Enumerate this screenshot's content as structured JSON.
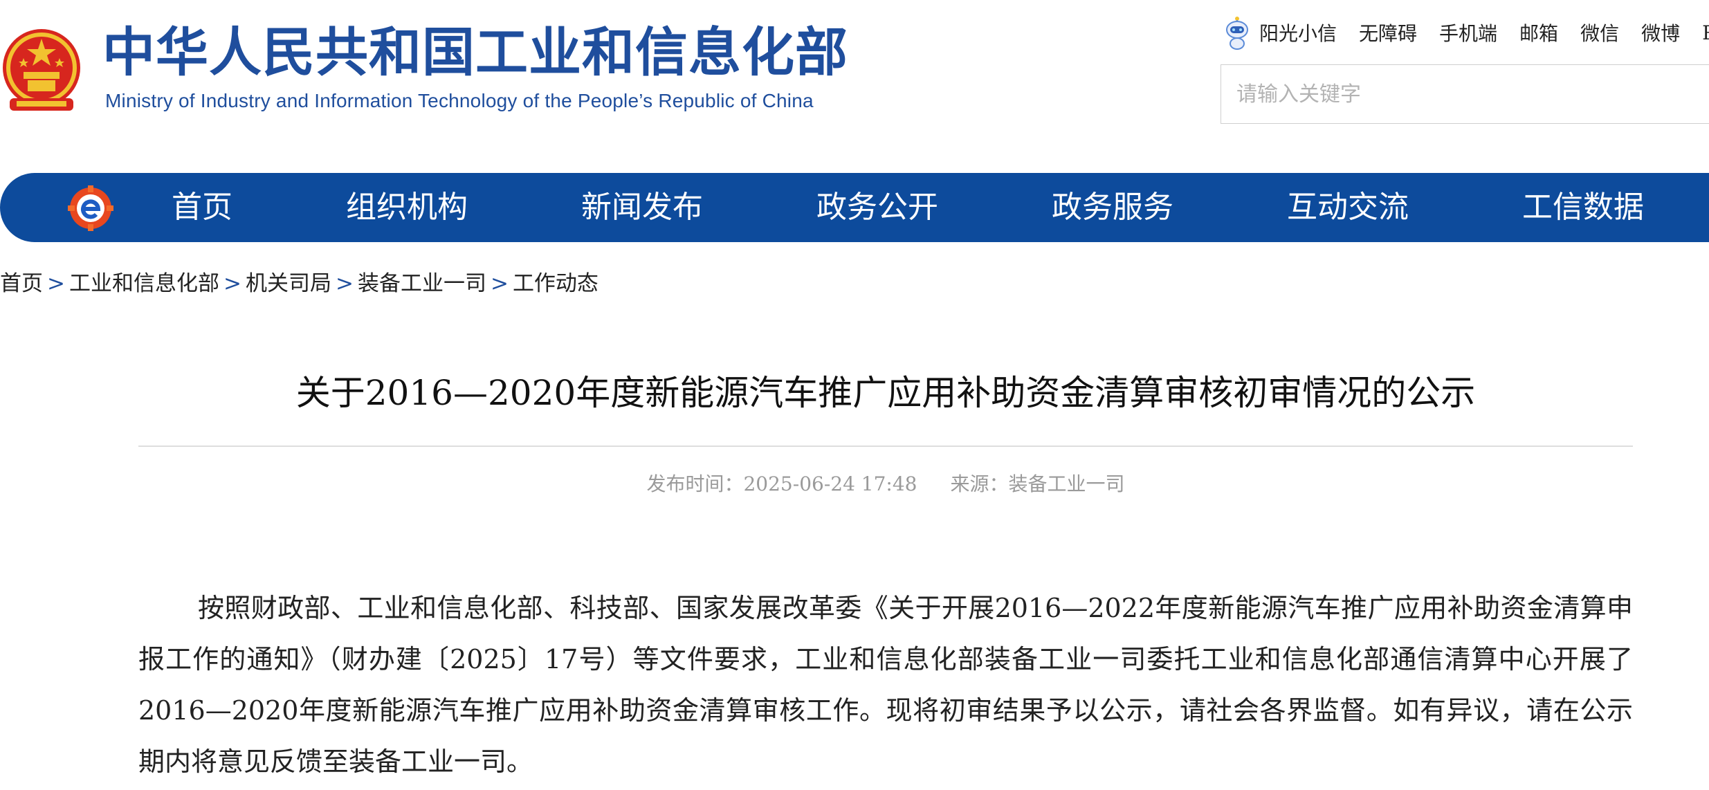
{
  "header": {
    "title_cn": "中华人民共和国工业和信息化部",
    "title_en": "Ministry of Industry and Information Technology of the People’s Republic of China",
    "emblem_icon": "national-emblem-icon",
    "top_links": [
      "阳光小信",
      "无障碍",
      "手机端",
      "邮箱",
      "微信",
      "微博",
      "RSS"
    ],
    "search": {
      "placeholder": "请输入关键字",
      "value": ""
    }
  },
  "nav": {
    "items": [
      "首页",
      "组织机构",
      "新闻发布",
      "政务公开",
      "政务服务",
      "互动交流",
      "工信数据"
    ]
  },
  "breadcrumb": {
    "items": [
      "首页",
      "工业和信息化部",
      "机关司局",
      "装备工业一司",
      "工作动态"
    ],
    "separator": ">"
  },
  "article": {
    "title": "关于2016—2020年度新能源汽车推广应用补助资金清算审核初审情况的公示",
    "publish_time": "发布时间：2025-06-24 17:48",
    "source": "来源：装备工业一司",
    "paragraph": "按照财政部、工业和信息化部、科技部、国家发展改革委《关于开展2016—2022年度新能源汽车推广应用补助资金清算申报工作的通知》（财办建〔2025〕17号）等文件要求，工业和信息化部装备工业一司委托工业和信息化部通信清算中心开展了2016—2020年度新能源汽车推广应用补助资金清算审核工作。现将初审结果予以公示，请社会各界监督。如有异议，请在公示期内将意见反馈至装备工业一司。"
  },
  "colors": {
    "brand_blue": "#1f4e9d",
    "nav_bg": "#0d4b9c",
    "meta_gray": "#9a9a9a"
  }
}
